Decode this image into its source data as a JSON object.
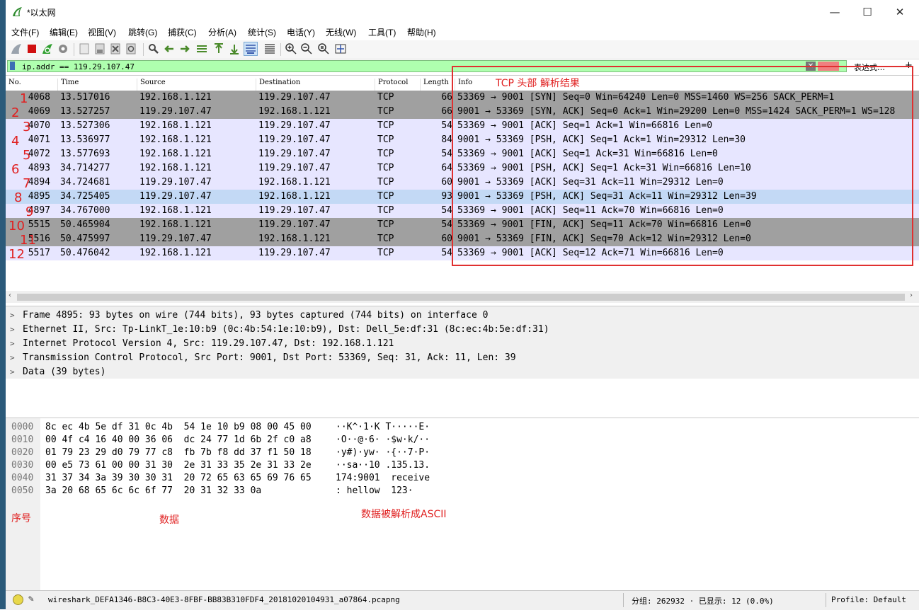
{
  "window": {
    "title": "*以太网",
    "minimize": "—",
    "maximize": "☐",
    "close": "✕"
  },
  "menu": [
    "文件(F)",
    "编辑(E)",
    "视图(V)",
    "跳转(G)",
    "捕获(C)",
    "分析(A)",
    "统计(S)",
    "电话(Y)",
    "无线(W)",
    "工具(T)",
    "帮助(H)"
  ],
  "toolbar_icons": [
    "shark-fin-start-icon",
    "stop-icon",
    "restart-icon",
    "capture-options-icon",
    "open-file-icon",
    "save-file-icon",
    "close-file-icon",
    "reload-icon",
    "find-packet-icon",
    "go-back-icon",
    "go-forward-icon",
    "go-to-packet-icon",
    "first-packet-icon",
    "last-packet-icon",
    "autoscroll-icon",
    "colorize-icon",
    "zoom-in-icon",
    "zoom-out-icon",
    "normal-size-icon",
    "resize-columns-icon"
  ],
  "filter": {
    "value": "ip.addr == 119.29.107.47",
    "clear": "✕",
    "expression_label": "表达式…",
    "add_label": "+"
  },
  "columns": [
    "No.",
    "Time",
    "Source",
    "Destination",
    "Protocol",
    "Length",
    "Info"
  ],
  "packets": [
    {
      "no": "4068",
      "time": "13.517016",
      "src": "192.168.1.121",
      "dst": "119.29.107.47",
      "proto": "TCP",
      "len": "66",
      "info": "53369 → 9001 [SYN] Seq=0 Win=64240 Len=0 MSS=1460 WS=256 SACK_PERM=1",
      "bg": "#a0a0a0"
    },
    {
      "no": "4069",
      "time": "13.527257",
      "src": "119.29.107.47",
      "dst": "192.168.1.121",
      "proto": "TCP",
      "len": "66",
      "info": "9001 → 53369 [SYN, ACK] Seq=0 Ack=1 Win=29200 Len=0 MSS=1424 SACK_PERM=1 WS=128",
      "bg": "#a0a0a0"
    },
    {
      "no": "4070",
      "time": "13.527306",
      "src": "192.168.1.121",
      "dst": "119.29.107.47",
      "proto": "TCP",
      "len": "54",
      "info": "53369 → 9001 [ACK] Seq=1 Ack=1 Win=66816 Len=0",
      "bg": "#e7e6ff"
    },
    {
      "no": "4071",
      "time": "13.536977",
      "src": "192.168.1.121",
      "dst": "119.29.107.47",
      "proto": "TCP",
      "len": "84",
      "info": "9001 → 53369 [PSH, ACK] Seq=1 Ack=1 Win=29312 Len=30",
      "bg": "#e7e6ff"
    },
    {
      "no": "4072",
      "time": "13.577693",
      "src": "192.168.1.121",
      "dst": "119.29.107.47",
      "proto": "TCP",
      "len": "54",
      "info": "53369 → 9001 [ACK] Seq=1 Ack=31 Win=66816 Len=0",
      "bg": "#e7e6ff"
    },
    {
      "no": "4893",
      "time": "34.714277",
      "src": "192.168.1.121",
      "dst": "119.29.107.47",
      "proto": "TCP",
      "len": "64",
      "info": "53369 → 9001 [PSH, ACK] Seq=1 Ack=31 Win=66816 Len=10",
      "bg": "#e7e6ff"
    },
    {
      "no": "4894",
      "time": "34.724681",
      "src": "119.29.107.47",
      "dst": "192.168.1.121",
      "proto": "TCP",
      "len": "60",
      "info": "9001 → 53369 [ACK] Seq=31 Ack=11 Win=29312 Len=0",
      "bg": "#e7e6ff"
    },
    {
      "no": "4895",
      "time": "34.725405",
      "src": "119.29.107.47",
      "dst": "192.168.1.121",
      "proto": "TCP",
      "len": "93",
      "info": "9001 → 53369 [PSH, ACK] Seq=31 Ack=11 Win=29312 Len=39",
      "bg": "#c3d9f5"
    },
    {
      "no": "4897",
      "time": "34.767000",
      "src": "192.168.1.121",
      "dst": "119.29.107.47",
      "proto": "TCP",
      "len": "54",
      "info": "53369 → 9001 [ACK] Seq=11 Ack=70 Win=66816 Len=0",
      "bg": "#e7e6ff"
    },
    {
      "no": "5515",
      "time": "50.465904",
      "src": "192.168.1.121",
      "dst": "119.29.107.47",
      "proto": "TCP",
      "len": "54",
      "info": "53369 → 9001 [FIN, ACK] Seq=11 Ack=70 Win=66816 Len=0",
      "bg": "#a0a0a0"
    },
    {
      "no": "5516",
      "time": "50.475997",
      "src": "119.29.107.47",
      "dst": "192.168.1.121",
      "proto": "TCP",
      "len": "60",
      "info": "9001 → 53369 [FIN, ACK] Seq=70 Ack=12 Win=29312 Len=0",
      "bg": "#a0a0a0"
    },
    {
      "no": "5517",
      "time": "50.476042",
      "src": "192.168.1.121",
      "dst": "119.29.107.47",
      "proto": "TCP",
      "len": "54",
      "info": "53369 → 9001 [ACK] Seq=12 Ack=71 Win=66816 Len=0",
      "bg": "#e7e6ff"
    }
  ],
  "details": [
    "Frame 4895: 93 bytes on wire (744 bits), 93 bytes captured (744 bits) on interface 0",
    "Ethernet II, Src: Tp-LinkT_1e:10:b9 (0c:4b:54:1e:10:b9), Dst: Dell_5e:df:31 (8c:ec:4b:5e:df:31)",
    "Internet Protocol Version 4, Src: 119.29.107.47, Dst: 192.168.1.121",
    "Transmission Control Protocol, Src Port: 9001, Dst Port: 53369, Seq: 31, Ack: 11, Len: 39",
    "Data (39 bytes)"
  ],
  "bytes": [
    {
      "offset": "0000",
      "hex": "8c ec 4b 5e df 31 0c 4b  54 1e 10 b9 08 00 45 00",
      "ascii": "··K^·1·K T·····E·"
    },
    {
      "offset": "0010",
      "hex": "00 4f c4 16 40 00 36 06  dc 24 77 1d 6b 2f c0 a8",
      "ascii": "·O··@·6· ·$w·k/··"
    },
    {
      "offset": "0020",
      "hex": "01 79 23 29 d0 79 77 c8  fb 7b f8 dd 37 f1 50 18",
      "ascii": "·y#)·yw· ·{··7·P·"
    },
    {
      "offset": "0030",
      "hex": "00 e5 73 61 00 00 31 30  2e 31 33 35 2e 31 33 2e",
      "ascii": "··sa··10 .135.13."
    },
    {
      "offset": "0040",
      "hex": "31 37 34 3a 39 30 30 31  20 72 65 63 65 69 76 65",
      "ascii": "174:9001  receive"
    },
    {
      "offset": "0050",
      "hex": "3a 20 68 65 6c 6c 6f 77  20 31 32 33 0a",
      "ascii": ": hellow  123·"
    }
  ],
  "status": {
    "file": "wireshark_DEFA1346-B8C3-40E3-8FBF-BB83B310FDF4_20181020104931_a07864.pcapng",
    "packets": "分组: 262932 · 已显示: 12 (0.0%)",
    "profile": "Profile: Default"
  },
  "annotations": {
    "info_title": "TCP 头部 解析结果",
    "seq_label": "序号",
    "data_label": "数据",
    "ascii_label": "数据被解析成ASCII",
    "row_numbers": [
      "1",
      "2",
      "3",
      "4",
      "5",
      "6",
      "7",
      "8",
      "9",
      "10",
      "11",
      "12"
    ]
  },
  "colors": {
    "filter_ok": "#afffaf",
    "selected_row": "#c3d9f5",
    "tcp_row": "#e7e6ff",
    "syn_fin_row": "#a0a0a0",
    "annotation": "#e02020"
  }
}
